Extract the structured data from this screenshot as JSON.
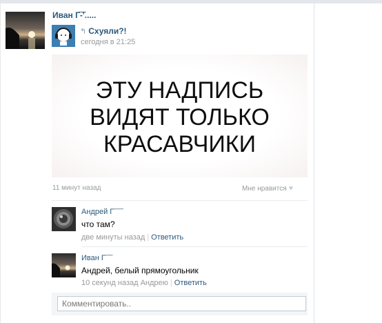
{
  "post": {
    "author": "Иван Г̄-̄ʹ̄.....",
    "group_name": "Схуяли?!",
    "time": "сегодня в 21:25",
    "image_lines": [
      "ЭТУ НАДПИСЬ",
      "ВИДЯТ ТОЛЬКО",
      "КРАСАВЧИКИ"
    ],
    "posted_ago": "11 минут назад",
    "like_label": "Мне нравится",
    "like_icon": "heart-icon"
  },
  "comments": [
    {
      "name": "Андрей Г̄ ̄ ̄ ̄ ̄",
      "text": "что там?",
      "time": "две минуты назад",
      "reply": "Ответить"
    },
    {
      "name": "Иван Г̄ ̄ ̄ ̄",
      "text": "Андрей, белый прямоугольник",
      "time": "10 секунд назад Андрею",
      "reply": "Ответить"
    }
  ],
  "comment_input": {
    "placeholder": "Комментировать.."
  },
  "colors": {
    "link": "#2b587a",
    "muted": "#999999",
    "border": "#e7ebef"
  }
}
